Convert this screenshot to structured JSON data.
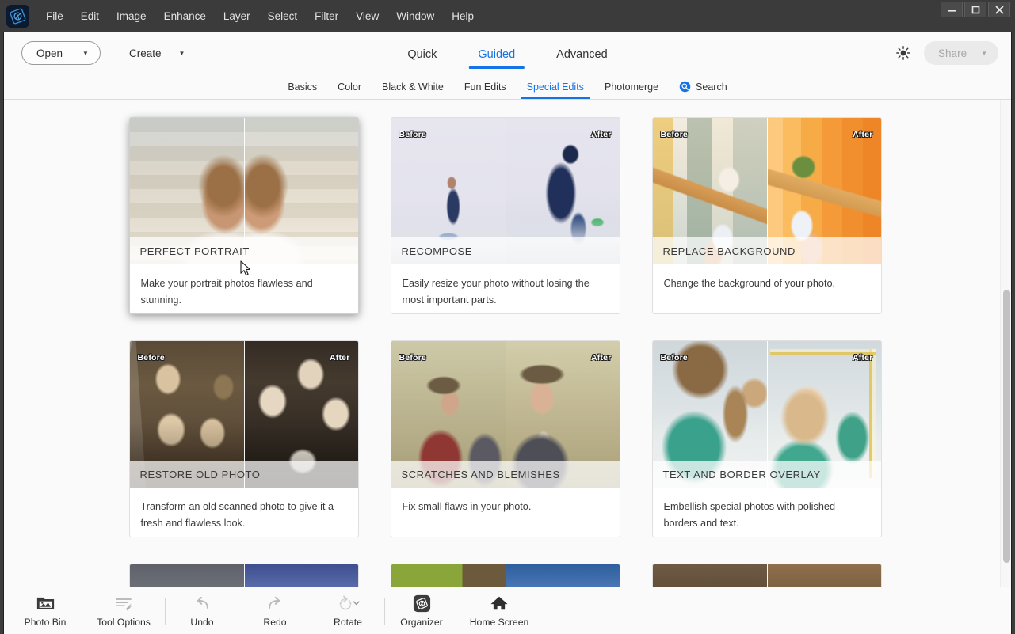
{
  "window": {
    "minimize_label": "–",
    "maximize_label": "□",
    "close_label": "✕"
  },
  "menubar": {
    "app_icon": "photoshop-elements-icon",
    "items": [
      "File",
      "Edit",
      "Image",
      "Enhance",
      "Layer",
      "Select",
      "Filter",
      "View",
      "Window",
      "Help"
    ]
  },
  "header": {
    "open_label": "Open",
    "create_label": "Create",
    "share_label": "Share",
    "brightness_icon": "brightness-icon",
    "mode_tabs": [
      {
        "label": "Quick",
        "active": false
      },
      {
        "label": "Guided",
        "active": true
      },
      {
        "label": "Advanced",
        "active": false
      }
    ]
  },
  "subtabs": {
    "items": [
      {
        "label": "Basics",
        "active": false
      },
      {
        "label": "Color",
        "active": false
      },
      {
        "label": "Black & White",
        "active": false
      },
      {
        "label": "Fun Edits",
        "active": false
      },
      {
        "label": "Special Edits",
        "active": true
      },
      {
        "label": "Photomerge",
        "active": false
      }
    ],
    "search_label": "Search",
    "search_icon": "search-icon"
  },
  "labels": {
    "before": "Before",
    "after": "After"
  },
  "cards": [
    {
      "title": "PERFECT PORTRAIT",
      "description": "Make your portrait photos flawless and stunning.",
      "hovered": true,
      "show_ba_labels": false
    },
    {
      "title": "RECOMPOSE",
      "description": "Easily resize your photo without losing the most important parts.",
      "hovered": false,
      "show_ba_labels": true
    },
    {
      "title": "REPLACE BACKGROUND",
      "description": "Change the background of your photo.",
      "hovered": false,
      "show_ba_labels": true
    },
    {
      "title": "RESTORE OLD PHOTO",
      "description": "Transform an old scanned photo to give it a fresh and flawless look.",
      "hovered": false,
      "show_ba_labels": true
    },
    {
      "title": "SCRATCHES AND BLEMISHES",
      "description": "Fix small flaws in your photo.",
      "hovered": false,
      "show_ba_labels": true
    },
    {
      "title": "TEXT AND BORDER OVERLAY",
      "description": "Embellish special photos with polished borders and text.",
      "hovered": false,
      "show_ba_labels": true
    }
  ],
  "toolbar": {
    "items": [
      {
        "label": "Photo Bin",
        "icon": "photo-bin-icon",
        "disabled": false
      },
      {
        "label": "Tool Options",
        "icon": "tool-options-icon",
        "disabled": true
      },
      {
        "label": "Undo",
        "icon": "undo-arrow-icon",
        "disabled": true
      },
      {
        "label": "Redo",
        "icon": "redo-arrow-icon",
        "disabled": true
      },
      {
        "label": "Rotate",
        "icon": "rotate-icon",
        "disabled": true
      },
      {
        "label": "Organizer",
        "icon": "organizer-icon",
        "disabled": false
      },
      {
        "label": "Home Screen",
        "icon": "home-icon",
        "disabled": false
      }
    ]
  },
  "colors": {
    "accent": "#1473e6",
    "titlebar_bg": "#3b3b3b",
    "page_bg": "#fafafa",
    "card_bg": "#ffffff"
  }
}
